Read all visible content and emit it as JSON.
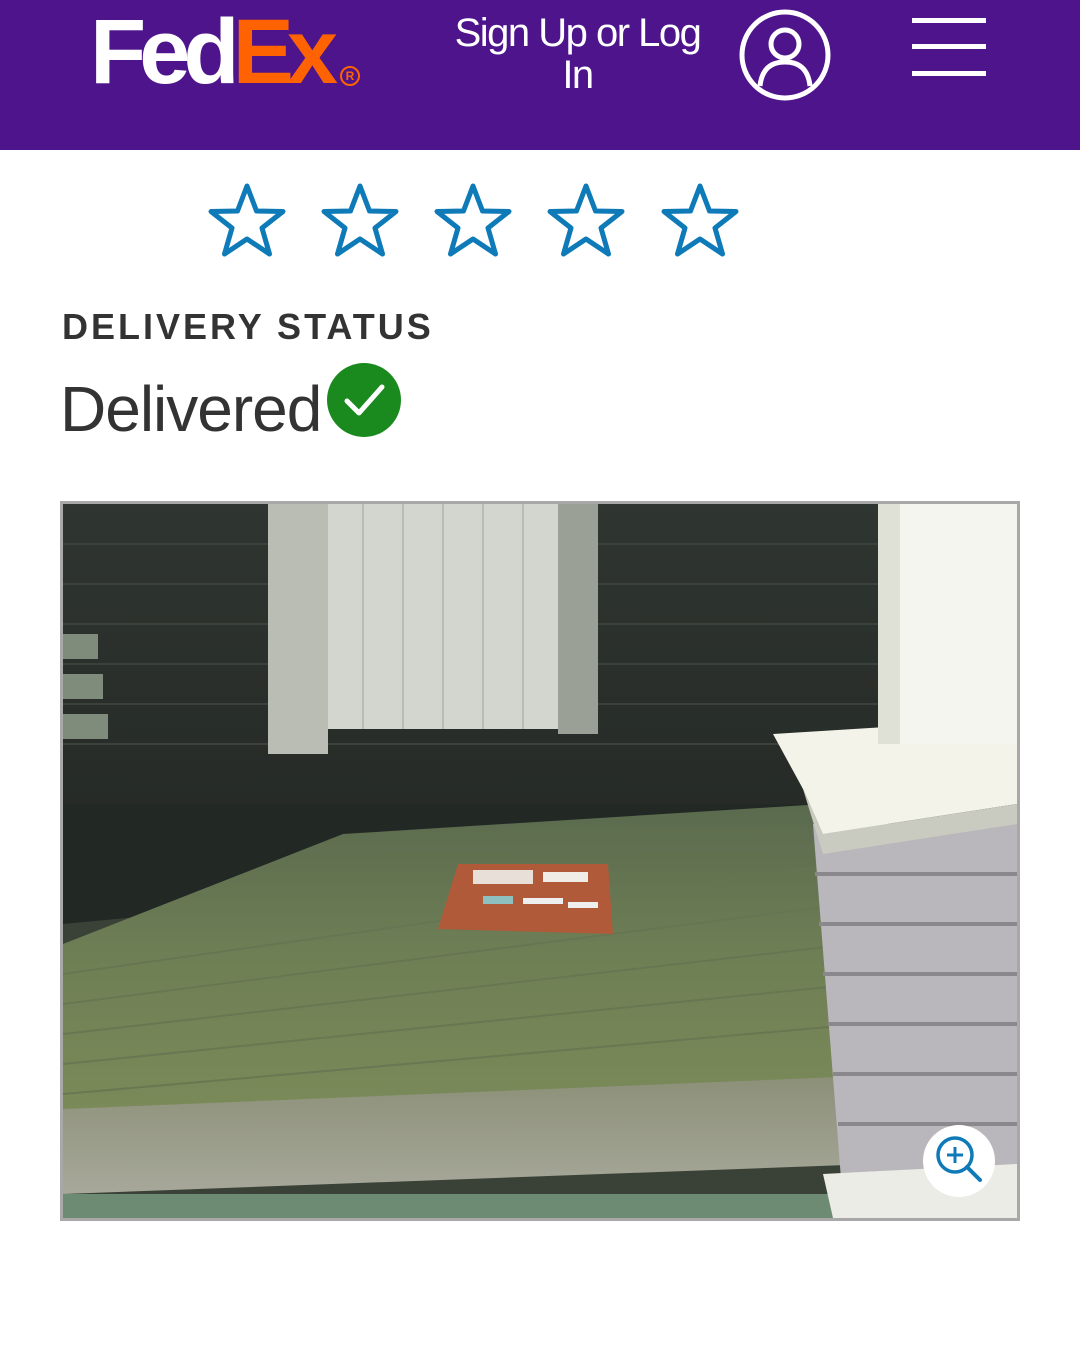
{
  "header": {
    "logo": {
      "fed": "Fed",
      "ex": "Ex",
      "reg": "R"
    },
    "signin_label_line1": "Sign Up or Log",
    "signin_label_line2": "In",
    "account_icon": "user-circle-icon",
    "menu_icon": "hamburger-menu-icon",
    "colors": {
      "background": "#4d148c",
      "logo_fed": "#ffffff",
      "logo_ex": "#ff6200"
    }
  },
  "rating": {
    "max": 5,
    "value": 0,
    "icon": "star-outline-icon",
    "color": "#0e7ab8"
  },
  "delivery": {
    "label": "DELIVERY STATUS",
    "status": "Delivered",
    "status_icon": "check-circle-icon",
    "status_color": "#1a8a1f"
  },
  "proof_photo": {
    "zoom_icon": "zoom-in-icon"
  }
}
